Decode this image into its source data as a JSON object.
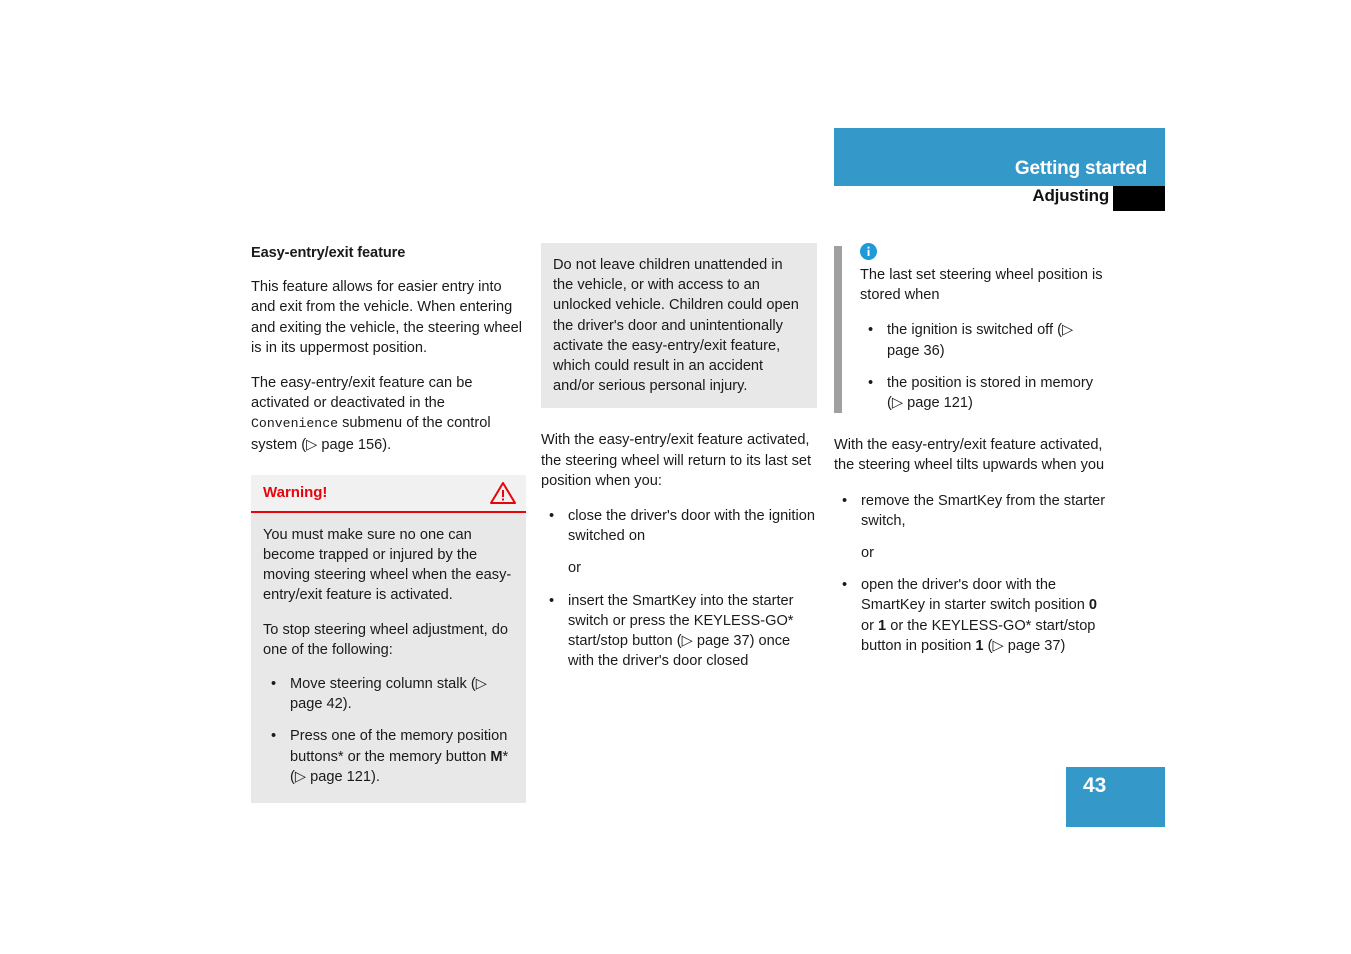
{
  "header": {
    "section_title": "Getting started",
    "sub_title": "Adjusting",
    "bar_color": "#3498c8",
    "tab_color": "#000000"
  },
  "page_number": "43",
  "column_1": {
    "section_heading": "Easy-entry/exit feature",
    "paragraph_1": "This feature allows for easier entry into and exit from the vehicle. When entering and exiting the vehicle, the steering wheel is in its uppermost position.",
    "paragraph_2_part1": "The easy-entry/exit feature can be activated or deactivated in the ",
    "paragraph_2_mono": "Convenience",
    "paragraph_2_part2": " submenu of the control system (▷ page 156).",
    "warning": {
      "title": "Warning!",
      "icon": "warning-triangle-icon",
      "accent_color": "#e8040c",
      "body_paragraph_1": "You must make sure no one can become trapped or injured by the moving steering wheel when the easy-entry/exit feature is activated.",
      "body_paragraph_2": "To stop steering wheel adjustment, do one of the following:",
      "bullets": [
        "Move steering column stalk (▷ page 42).",
        "Press one of the memory position buttons* or the memory button M* (▷ page 121)."
      ],
      "bullet_2_pre": "Press one of the memory position buttons* or the memory button ",
      "bullet_2_bold": "M",
      "bullet_2_post": "* (▷ page 121)."
    }
  },
  "column_2": {
    "gray_note": "Do not leave children unattended in the vehicle, or with access to an unlocked vehicle. Children could open the driver's door and unintentionally activate the easy-entry/exit feature, which could result in an accident and/or serious personal injury.",
    "paragraph_1": "With the easy-entry/exit feature activated, the steering wheel will return to its last set position when you:",
    "bullet_1": "close the driver's door with the ignition switched on",
    "connector": "or",
    "bullet_2": "insert the SmartKey into the starter switch or press the KEYLESS-GO* start/stop button (▷ page 37) once with the driver's door closed"
  },
  "column_3": {
    "info": {
      "icon": "info-circle-icon",
      "icon_color": "#1e9ad6",
      "intro": "The last set steering wheel position is stored when",
      "bullets": [
        "the ignition is switched off (▷ page 36)",
        "the position is stored in memory (▷ page 121)"
      ]
    },
    "paragraph_1": "With the easy-entry/exit feature activated, the steering wheel tilts upwards when you",
    "bullet_1": "remove the SmartKey from the starter switch,",
    "connector": "or",
    "bullet_2_pre": "open the driver's door with the SmartKey in starter switch position ",
    "bullet_2_b1": "0",
    "bullet_2_mid1": " or ",
    "bullet_2_b2": "1",
    "bullet_2_mid2": " or the KEYLESS-GO* start/stop button in position ",
    "bullet_2_b3": "1",
    "bullet_2_post": " (▷ page 37)"
  },
  "glyphs": {
    "bullet": "•"
  }
}
